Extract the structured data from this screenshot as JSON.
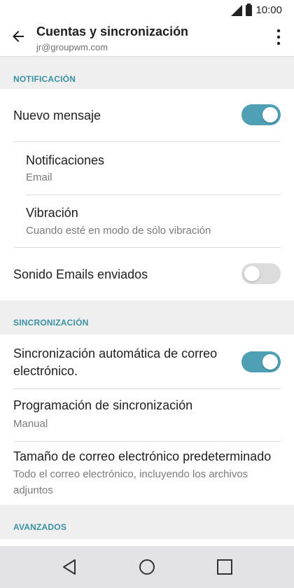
{
  "status_bar": {
    "time": "10:00"
  },
  "app_bar": {
    "title": "Cuentas y sincronización",
    "subtitle": "jr@groupwm.com",
    "back_icon": "arrow-left-icon",
    "menu_icon": "more-vert-icon"
  },
  "sections": {
    "notificacion": {
      "header": "NOTIFICACIÓN"
    },
    "sincronizacion": {
      "header": "SINCRONIZACIÓN"
    },
    "avanzados": {
      "header": "AVANZADOS"
    }
  },
  "settings": {
    "nuevo_mensaje": {
      "label": "Nuevo mensaje",
      "enabled": true
    },
    "notificaciones": {
      "label": "Notificaciones",
      "value": "Email"
    },
    "vibracion": {
      "label": "Vibración",
      "value": "Cuando esté en modo de sólo vibración"
    },
    "sonido_enviados": {
      "label": "Sonido Emails enviados",
      "enabled": false
    },
    "sync_auto": {
      "label_line1": "Sincronización automática de correo",
      "label_line2": "electrónico.",
      "enabled": true
    },
    "programacion": {
      "label": "Programación de sincronización",
      "value": "Manual"
    },
    "tamano": {
      "label": "Tamaño de correo electrónico predeterminado",
      "value_line1": "Todo el correo electrónico, incluyendo los archivos",
      "value_line2": "adjuntos"
    }
  },
  "colors": {
    "accent": "#3a8fa3",
    "toggle_on": "#4f9fb5",
    "toggle_off": "#dcdcdc",
    "background": "#efefef"
  },
  "nav_bar": {
    "back_icon": "triangle-back-icon",
    "home_icon": "circle-home-icon",
    "recents_icon": "square-recents-icon"
  }
}
